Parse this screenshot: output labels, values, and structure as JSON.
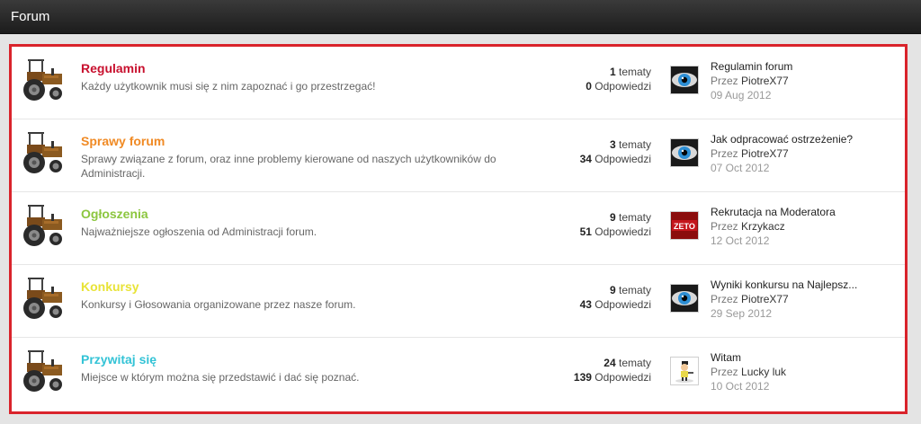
{
  "header": {
    "title": "Forum"
  },
  "forums": [
    {
      "title": "Regulamin",
      "title_color": "#c8102e",
      "description": "Każdy użytkownik musi się z nim zapoznać i go przestrzegać!",
      "topics_count": "1",
      "topics_label": "tematy",
      "replies_count": "0",
      "replies_label": "Odpowiedzi",
      "last_post": {
        "avatar": "eye-avatar",
        "topic": "Regulamin forum",
        "by_label": "Przez",
        "user": "PiotreX77",
        "date": "09 Aug 2012"
      }
    },
    {
      "title": "Sprawy forum",
      "title_color": "#f08a24",
      "description": "Sprawy związane z forum, oraz inne problemy kierowane od naszych użytkowników do Administracji.",
      "topics_count": "3",
      "topics_label": "tematy",
      "replies_count": "34",
      "replies_label": "Odpowiedzi",
      "last_post": {
        "avatar": "eye-avatar",
        "topic": "Jak odpracować ostrzeżenie?",
        "by_label": "Przez",
        "user": "PiotreX77",
        "date": "07 Oct 2012"
      }
    },
    {
      "title": "Ogłoszenia",
      "title_color": "#8cc63f",
      "description": "Najważniejsze ogłoszenia od Administracji forum.",
      "topics_count": "9",
      "topics_label": "tematy",
      "replies_count": "51",
      "replies_label": "Odpowiedzi",
      "last_post": {
        "avatar": "zeta-avatar",
        "topic": "Rekrutacja na Moderatora",
        "by_label": "Przez",
        "user": "Krzykacz",
        "date": "12 Oct 2012"
      }
    },
    {
      "title": "Konkursy",
      "title_color": "#e8e337",
      "description": "Konkursy i Głosowania organizowane przez nasze forum.",
      "topics_count": "9",
      "topics_label": "tematy",
      "replies_count": "43",
      "replies_label": "Odpowiedzi",
      "last_post": {
        "avatar": "eye-avatar",
        "topic": "Wyniki konkursu na Najlepsz...",
        "by_label": "Przez",
        "user": "PiotreX77",
        "date": "29 Sep 2012"
      }
    },
    {
      "title": "Przywitaj się",
      "title_color": "#33c3d6",
      "description": "Miejsce w którym można się przedstawić i dać się poznać.",
      "topics_count": "24",
      "topics_label": "tematy",
      "replies_count": "139",
      "replies_label": "Odpowiedzi",
      "last_post": {
        "avatar": "cartoon-avatar",
        "topic": "Witam",
        "by_label": "Przez",
        "user": "Lucky luk",
        "date": "10 Oct 2012"
      }
    }
  ],
  "colors": {
    "frame_border": "#d9232b",
    "header_bg": "#2a2a2a"
  }
}
